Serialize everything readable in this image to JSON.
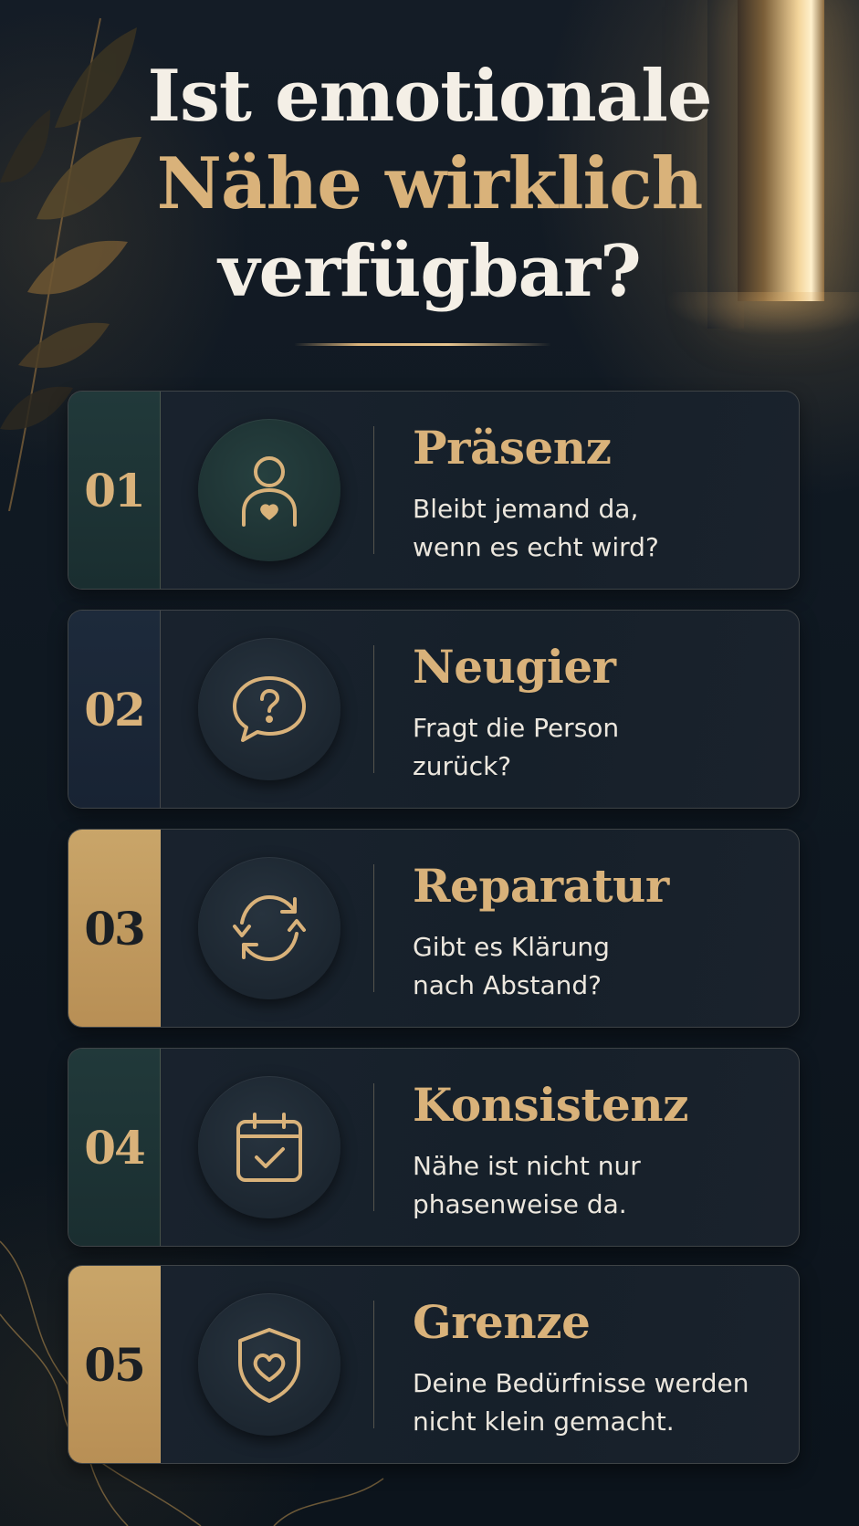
{
  "title": {
    "line1": "Ist emotionale",
    "line2": "Nähe wirklich",
    "line3": "verfügbar?"
  },
  "colors": {
    "gold": "#d9b27a",
    "background": "#0f1821",
    "teal_panel": "#21393a",
    "navy_panel": "#1d2a3b",
    "gold_panel": "#c9a569"
  },
  "items": [
    {
      "number": "01",
      "title": "Präsenz",
      "text": "Bleibt jemand da,\nwenn es echt wird?",
      "icon": "person-heart-icon"
    },
    {
      "number": "02",
      "title": "Neugier",
      "text": "Fragt die Person\nzurück?",
      "icon": "question-bubble-icon"
    },
    {
      "number": "03",
      "title": "Reparatur",
      "text": "Gibt es Klärung\nnach Abstand?",
      "icon": "refresh-cycle-icon"
    },
    {
      "number": "04",
      "title": "Konsistenz",
      "text": "Nähe ist nicht nur\nphasenweise da.",
      "icon": "calendar-check-icon"
    },
    {
      "number": "05",
      "title": "Grenze",
      "text": "Deine Bedürfnisse werden\nnicht klein gemacht.",
      "icon": "shield-heart-icon"
    }
  ]
}
